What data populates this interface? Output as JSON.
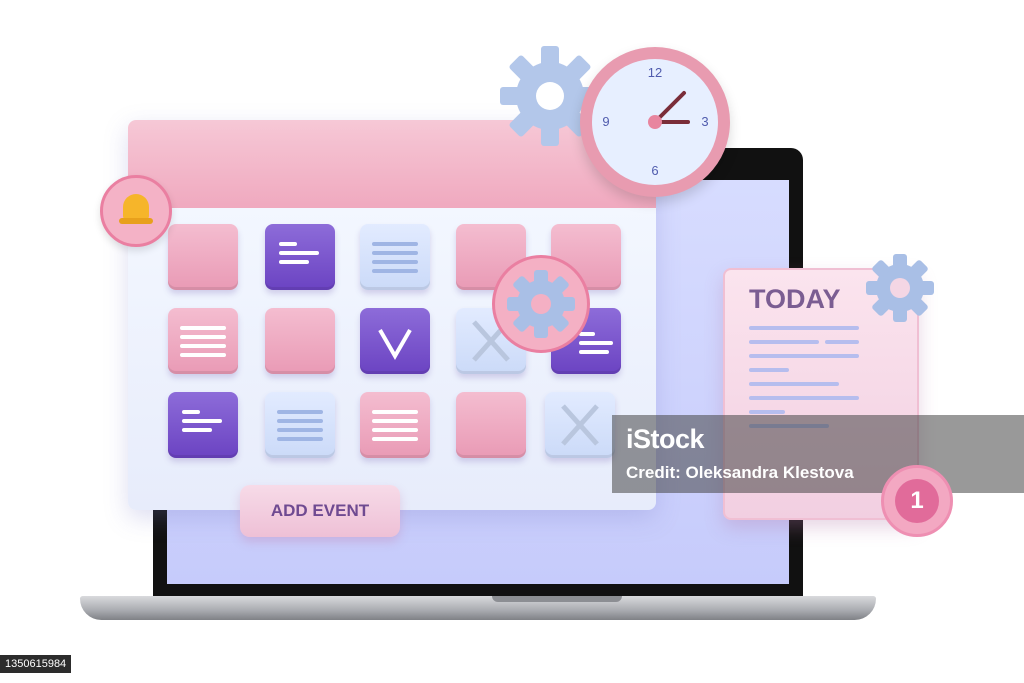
{
  "calendar": {
    "add_event_label": "ADD EVENT"
  },
  "clock": {
    "numbers": {
      "twelve": "12",
      "three": "3",
      "six": "6",
      "nine": "9"
    },
    "face_color": "#e7efff",
    "rim_color": "#e89bb0"
  },
  "today_note": {
    "title": "TODAY"
  },
  "notification": {
    "count": "1"
  },
  "watermark": {
    "brand": "iStock",
    "credit": "Credit: Oleksandra Klestova"
  },
  "stock_id": "1350615984",
  "colors": {
    "pink_tile": "#f4bdd0",
    "purple_tile": "#6b43c2",
    "light_tile": "#cbdaf8",
    "gear": "#a9bfe6",
    "accent_pink": "#ea7fa1",
    "text_purple": "#6f4a91"
  },
  "icons": [
    "bell-icon",
    "gear-icon",
    "clock-icon",
    "check-icon",
    "x-icon",
    "text-lines-icon"
  ]
}
